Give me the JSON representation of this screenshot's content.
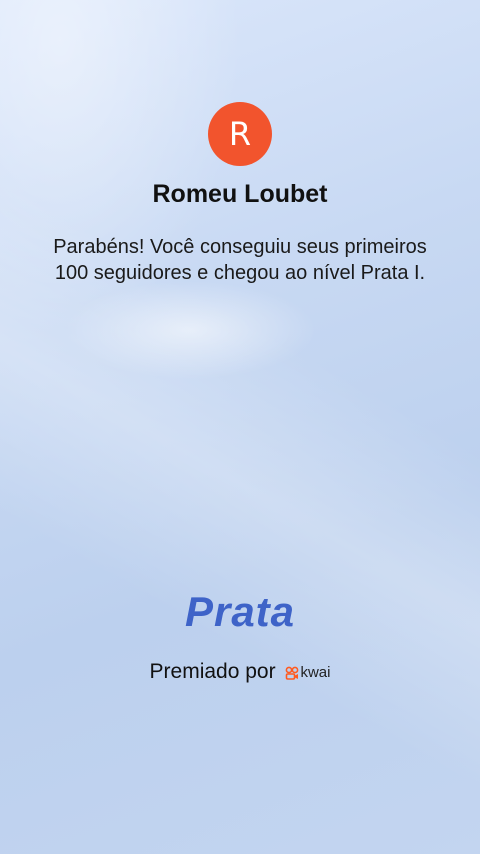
{
  "profile": {
    "avatar_initial": "R",
    "name": "Romeu Loubet"
  },
  "message": "Parabéns! Você conseguiu seus primeiros 100 seguidores e chegou ao nível Prata I.",
  "level": {
    "title": "Prata"
  },
  "footer": {
    "awarded_by": "Premiado por",
    "brand_name": "kwai",
    "brand_icon": "kwai-logo-icon"
  },
  "colors": {
    "avatar_bg": "#f2542d",
    "level_title": "#3e63c8",
    "brand_accent": "#ff5a1f"
  }
}
